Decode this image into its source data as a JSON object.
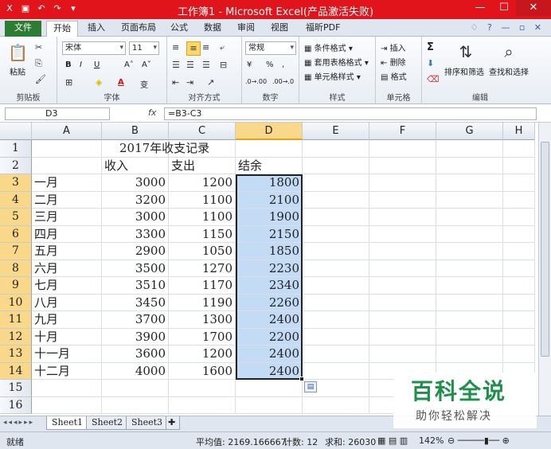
{
  "window": {
    "title": "工作簿1 - Microsoft Excel(产品激活失败)",
    "qat_icons": [
      "excel-icon",
      "save-icon",
      "undo-icon",
      "redo-icon"
    ],
    "min_label": "—",
    "max_label": "☐",
    "close_label": "✕"
  },
  "tabs": {
    "file": "文件",
    "items": [
      "开始",
      "插入",
      "页面布局",
      "公式",
      "数据",
      "审阅",
      "视图",
      "福昕PDF"
    ],
    "active": "开始",
    "right_icons": "♢ ? — ▫ ✕"
  },
  "ribbon": {
    "clipboard": {
      "label": "剪贴板",
      "paste": "粘贴"
    },
    "font": {
      "label": "字体",
      "name": "宋体",
      "size": "11",
      "bold": "B",
      "italic": "I",
      "underline": "U",
      "grow": "A˄",
      "shrink": "A˅",
      "fontcolor": "A",
      "phonetic": "变"
    },
    "alignment": {
      "label": "对齐方式"
    },
    "number": {
      "label": "数字",
      "format": "常规",
      "percent": "%",
      "comma": ",",
      "dec_inc": ".0→.00",
      "dec_dec": ".00→.0",
      "currency": "¥"
    },
    "styles": {
      "label": "样式",
      "cond": "条件格式",
      "table": "套用表格格式",
      "cell": "单元格样式"
    },
    "cells": {
      "label": "单元格",
      "insert": "插入",
      "delete": "删除",
      "format": "格式"
    },
    "editing": {
      "label": "编辑",
      "sum": "Σ",
      "sort": "排序和筛选",
      "find": "查找和选择"
    }
  },
  "formula_bar": {
    "name_box": "D3",
    "fx": "fx",
    "formula": "=B3-C3"
  },
  "columns": [
    "A",
    "B",
    "C",
    "D",
    "E",
    "F",
    "G",
    "H"
  ],
  "rows": [
    "1",
    "2",
    "3",
    "4",
    "5",
    "6",
    "7",
    "8",
    "9",
    "10",
    "11",
    "12",
    "13",
    "14",
    "15",
    "16"
  ],
  "sheet": {
    "title": "2017年收支记录",
    "headers": {
      "b": "收入",
      "c": "支出",
      "d": "结余"
    },
    "data": [
      {
        "month": "一月",
        "income": "3000",
        "expense": "1200",
        "balance": "1800"
      },
      {
        "month": "二月",
        "income": "3200",
        "expense": "1100",
        "balance": "2100"
      },
      {
        "month": "三月",
        "income": "3000",
        "expense": "1100",
        "balance": "1900"
      },
      {
        "month": "四月",
        "income": "3300",
        "expense": "1150",
        "balance": "2150"
      },
      {
        "month": "五月",
        "income": "2900",
        "expense": "1050",
        "balance": "1850"
      },
      {
        "month": "六月",
        "income": "3500",
        "expense": "1270",
        "balance": "2230"
      },
      {
        "month": "七月",
        "income": "3510",
        "expense": "1170",
        "balance": "2340"
      },
      {
        "month": "八月",
        "income": "3450",
        "expense": "1190",
        "balance": "2260"
      },
      {
        "month": "九月",
        "income": "3700",
        "expense": "1300",
        "balance": "2400"
      },
      {
        "month": "十月",
        "income": "3900",
        "expense": "1700",
        "balance": "2200"
      },
      {
        "month": "十一月",
        "income": "3600",
        "expense": "1200",
        "balance": "2400"
      },
      {
        "month": "十二月",
        "income": "4000",
        "expense": "1600",
        "balance": "2400"
      }
    ]
  },
  "sheet_tabs": [
    "Sheet1",
    "Sheet2",
    "Sheet3"
  ],
  "status": {
    "ready": "就绪",
    "average": "平均值: 2169.166667",
    "count": "计数: 12",
    "sum": "求和: 26030",
    "zoom": "142%"
  },
  "watermark": {
    "title": "百科全说",
    "subtitle": "助你轻松解决"
  },
  "colors": {
    "titlebar": "#e0141a",
    "selection": "#c4dbf5",
    "header_selected": "#f9d88a",
    "file_tab": "#2c7c33"
  }
}
